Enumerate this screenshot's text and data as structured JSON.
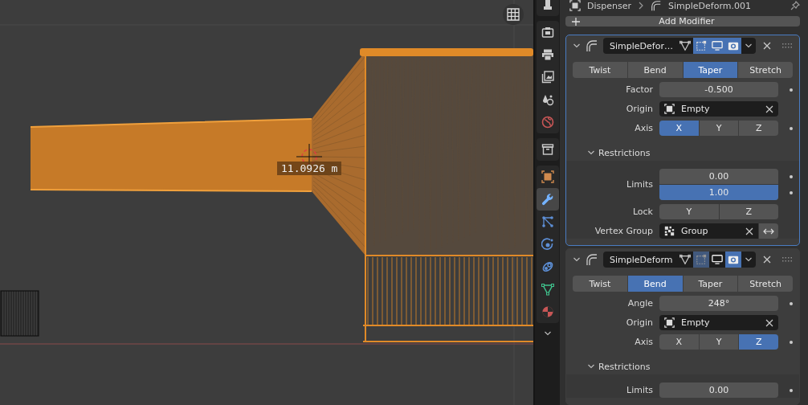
{
  "header": {
    "object": "Dispenser",
    "modifier": "SimpleDeform.001"
  },
  "viewport": {
    "measurement": "11.0926 m"
  },
  "sidebar_tabs": [
    {
      "tabs": [
        {
          "kind": "tool",
          "selected": false
        }
      ]
    },
    {
      "tabs": [
        {
          "kind": "render",
          "selected": false
        },
        {
          "kind": "output",
          "selected": false
        },
        {
          "kind": "view_layer",
          "selected": false
        },
        {
          "kind": "scene",
          "selected": false
        },
        {
          "kind": "world",
          "selected": false
        }
      ]
    },
    {
      "tabs": [
        {
          "kind": "collection",
          "selected": false
        }
      ]
    },
    {
      "tabs": [
        {
          "kind": "object",
          "selected": false
        },
        {
          "kind": "modifiers",
          "selected": true
        },
        {
          "kind": "particles",
          "selected": false
        },
        {
          "kind": "physics",
          "selected": false
        },
        {
          "kind": "constraints",
          "selected": false
        },
        {
          "kind": "data",
          "selected": false
        },
        {
          "kind": "material",
          "selected": false
        }
      ]
    }
  ],
  "add_modifier": "Add Modifier",
  "modifiers": [
    {
      "name": "SimpleDefor…",
      "active": true,
      "expanded": true,
      "toggles": [
        {
          "kind": "edit_mode",
          "on": false,
          "disabled": false
        },
        {
          "kind": "cage",
          "on": true,
          "disabled": false
        },
        {
          "kind": "viewport",
          "on": true,
          "disabled": false
        },
        {
          "kind": "render",
          "on": true,
          "disabled": false
        }
      ],
      "modes": [
        {
          "label": "Twist",
          "selected": false
        },
        {
          "label": "Bend",
          "selected": false
        },
        {
          "label": "Taper",
          "selected": true
        },
        {
          "label": "Stretch",
          "selected": false
        }
      ],
      "rows": [
        {
          "kind": "number",
          "label": "Factor",
          "value": "-0.500",
          "animatable": true
        },
        {
          "kind": "object",
          "label": "Origin",
          "value": "Empty",
          "animatable": false
        },
        {
          "kind": "axis",
          "label": "Axis",
          "animatable": true,
          "options": [
            {
              "label": "X",
              "selected": true
            },
            {
              "label": "Y",
              "selected": false
            },
            {
              "label": "Z",
              "selected": false
            }
          ]
        }
      ],
      "restrictions": {
        "label": "Restrictions",
        "expanded": true,
        "rows": [
          {
            "kind": "range",
            "label": "Limits",
            "animatable": true,
            "sliders": [
              {
                "value": "0.00",
                "level": 0
              },
              {
                "value": "1.00",
                "level": 1
              }
            ]
          },
          {
            "kind": "axis",
            "label": "Lock",
            "animatable": false,
            "options": [
              {
                "label": "Y",
                "selected": false
              },
              {
                "label": "Z",
                "selected": false
              }
            ]
          },
          {
            "kind": "vgroup",
            "label": "Vertex Group",
            "value": "Group",
            "animatable": false,
            "invert": false
          }
        ]
      }
    },
    {
      "name": "SimpleDeform",
      "active": false,
      "expanded": true,
      "toggles": [
        {
          "kind": "edit_mode",
          "on": false,
          "disabled": false
        },
        {
          "kind": "cage",
          "on": true,
          "disabled": true
        },
        {
          "kind": "viewport",
          "on": false,
          "disabled": false
        },
        {
          "kind": "render",
          "on": true,
          "disabled": false
        }
      ],
      "modes": [
        {
          "label": "Twist",
          "selected": false
        },
        {
          "label": "Bend",
          "selected": true
        },
        {
          "label": "Taper",
          "selected": false
        },
        {
          "label": "Stretch",
          "selected": false
        }
      ],
      "rows": [
        {
          "kind": "number",
          "label": "Angle",
          "value": "248°",
          "animatable": true
        },
        {
          "kind": "object",
          "label": "Origin",
          "value": "Empty",
          "animatable": false
        },
        {
          "kind": "axis",
          "label": "Axis",
          "animatable": true,
          "options": [
            {
              "label": "X",
              "selected": false
            },
            {
              "label": "Y",
              "selected": false
            },
            {
              "label": "Z",
              "selected": true
            }
          ]
        }
      ],
      "restrictions": {
        "label": "Restrictions",
        "expanded": true,
        "rows": [
          {
            "kind": "range",
            "label": "Limits",
            "animatable": true,
            "sliders": [
              {
                "value": "0.00",
                "level": 0
              }
            ]
          }
        ]
      }
    }
  ]
}
